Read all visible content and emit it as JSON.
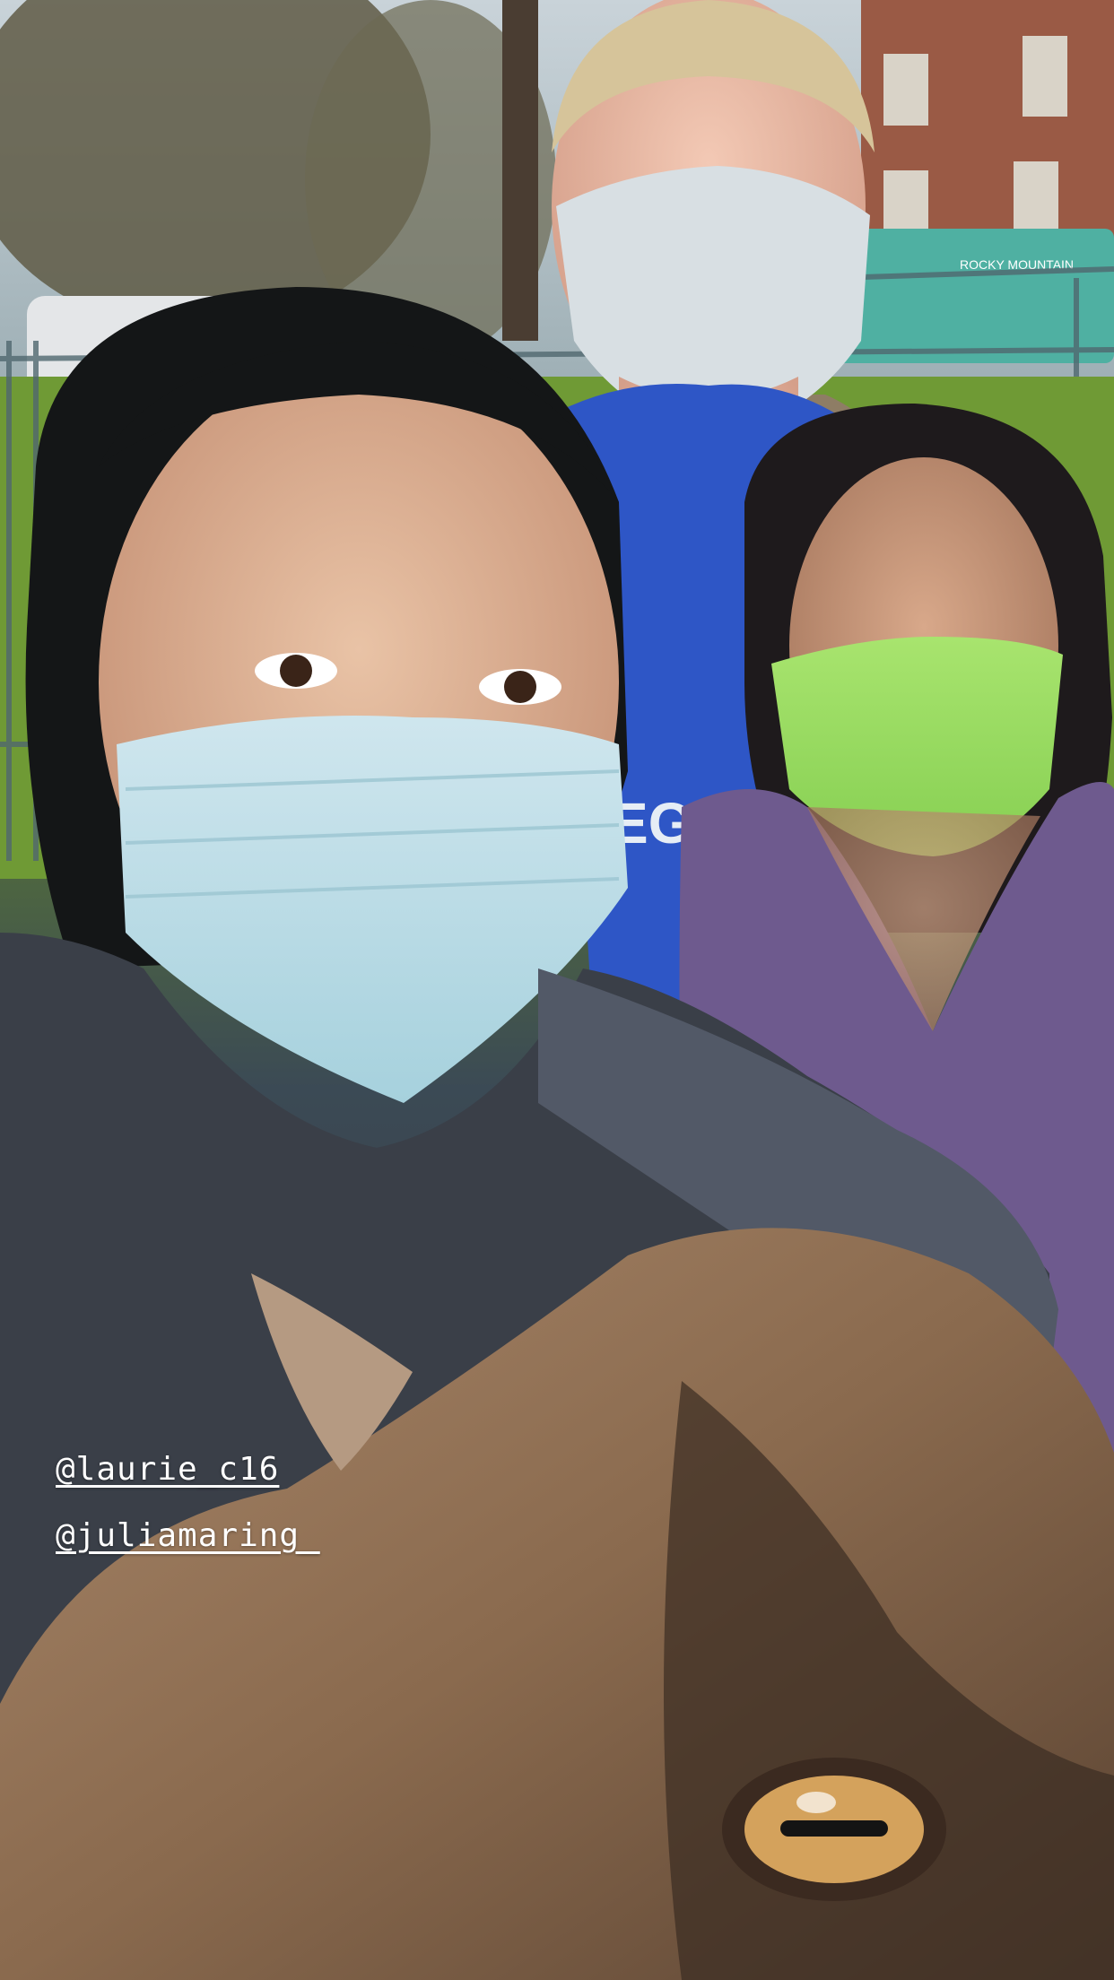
{
  "story": {
    "mentions": [
      {
        "text": "@laurie_c16"
      },
      {
        "text": "@juliamaring_"
      }
    ],
    "photo_text": {
      "shirt_text": "EG",
      "bus_text": "ROCKY MOUNTAIN"
    }
  }
}
